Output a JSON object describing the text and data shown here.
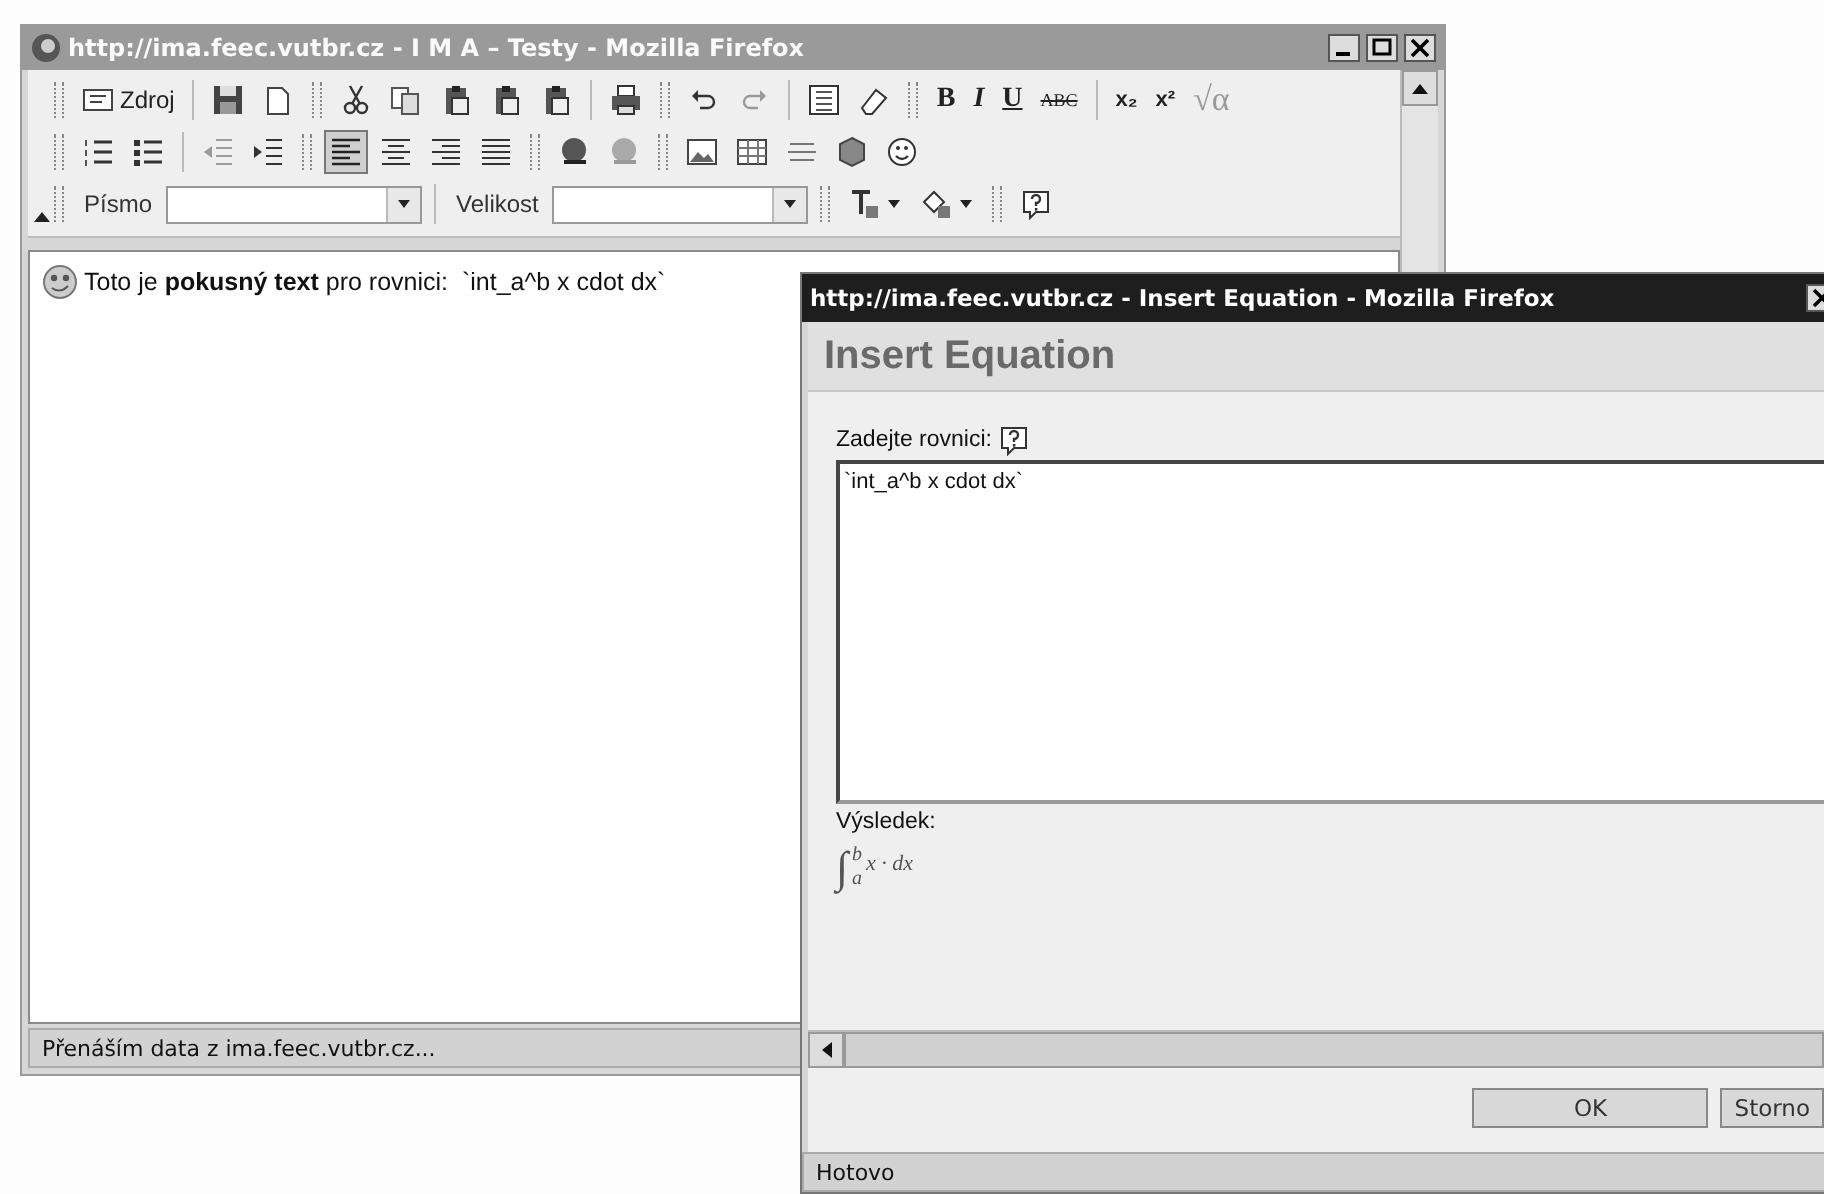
{
  "main_window": {
    "title": "http://ima.feec.vutbr.cz - I M A – Testy - Mozilla Firefox",
    "toolbar": {
      "rows": [
        [
          {
            "kind": "grip"
          },
          {
            "kind": "source",
            "label": "Zdroj",
            "pressed": false
          },
          {
            "kind": "separator"
          },
          {
            "kind": "icon",
            "pressed": false
          },
          {
            "kind": "icon",
            "pressed": false
          },
          {
            "kind": "grip"
          },
          {
            "kind": "icon",
            "pressed": false
          },
          {
            "kind": "icon",
            "pressed": false
          },
          {
            "kind": "icon",
            "pressed": false
          },
          {
            "kind": "icon",
            "pressed": false
          },
          {
            "kind": "icon",
            "pressed": false
          },
          {
            "kind": "separator"
          },
          {
            "kind": "icon",
            "pressed": false
          },
          {
            "kind": "grip"
          },
          {
            "kind": "icon",
            "pressed": false
          },
          {
            "kind": "icon",
            "pressed": false
          },
          {
            "kind": "separator"
          },
          {
            "kind": "icon",
            "pressed": false
          },
          {
            "kind": "icon",
            "pressed": false
          },
          {
            "kind": "grip"
          },
          {
            "kind": "bold",
            "label": "B",
            "pressed": false
          },
          {
            "kind": "italic",
            "label": "I",
            "pressed": false
          },
          {
            "kind": "underline",
            "label": "U",
            "pressed": false
          },
          {
            "kind": "strike",
            "label": "ABC",
            "pressed": false
          },
          {
            "kind": "separator"
          },
          {
            "kind": "script",
            "label": "x₂",
            "pressed": false
          },
          {
            "kind": "script",
            "label": "x²",
            "pressed": false
          },
          {
            "kind": "formula",
            "label": "√α",
            "pressed": false
          }
        ],
        [
          {
            "kind": "grip"
          },
          {
            "kind": "icon",
            "pressed": false
          },
          {
            "kind": "icon",
            "pressed": false
          },
          {
            "kind": "separator"
          },
          {
            "kind": "icon",
            "pressed": false
          },
          {
            "kind": "icon",
            "pressed": false
          },
          {
            "kind": "grip"
          },
          {
            "kind": "icon",
            "pressed": true
          },
          {
            "kind": "icon",
            "pressed": false
          },
          {
            "kind": "icon",
            "pressed": false
          },
          {
            "kind": "icon",
            "pressed": false
          },
          {
            "kind": "grip"
          },
          {
            "kind": "icon",
            "pressed": false
          },
          {
            "kind": "icon",
            "pressed": false
          },
          {
            "kind": "grip"
          },
          {
            "kind": "icon",
            "pressed": false
          },
          {
            "kind": "icon",
            "pressed": false
          },
          {
            "kind": "icon",
            "pressed": false
          },
          {
            "kind": "icon",
            "pressed": false
          },
          {
            "kind": "icon",
            "pressed": false
          }
        ],
        [
          {
            "kind": "grip"
          },
          {
            "kind": "select",
            "label": "Písmo"
          },
          {
            "kind": "separator"
          },
          {
            "kind": "select",
            "label": "Velikost"
          },
          {
            "kind": "grip"
          },
          {
            "kind": "color_menu",
            "pressed": false
          },
          {
            "kind": "color_menu",
            "pressed": false
          },
          {
            "kind": "grip"
          },
          {
            "kind": "icon",
            "pressed": false
          }
        ]
      ]
    },
    "editor": {
      "paragraph": "Toto je **pokusný text** pro rovnici:  `int_a^b x cdot dx`"
    },
    "status_bar": "Přenáším data z ima.feec.vutbr.cz..."
  },
  "dialog": {
    "title": "http://ima.feec.vutbr.cz - Insert Equation - Mozilla Firefox",
    "heading": "Insert Equation",
    "equation_label": "Zadejte rovnici:",
    "equation_value": "`int_a^b x cdot dx`",
    "result_label": "Výsledek:",
    "result": {
      "operator": "∫",
      "lower": "a",
      "upper": "b",
      "expression": "x · dx"
    },
    "buttons": [
      "OK",
      "Storno"
    ],
    "status_bar": "Hotovo"
  }
}
